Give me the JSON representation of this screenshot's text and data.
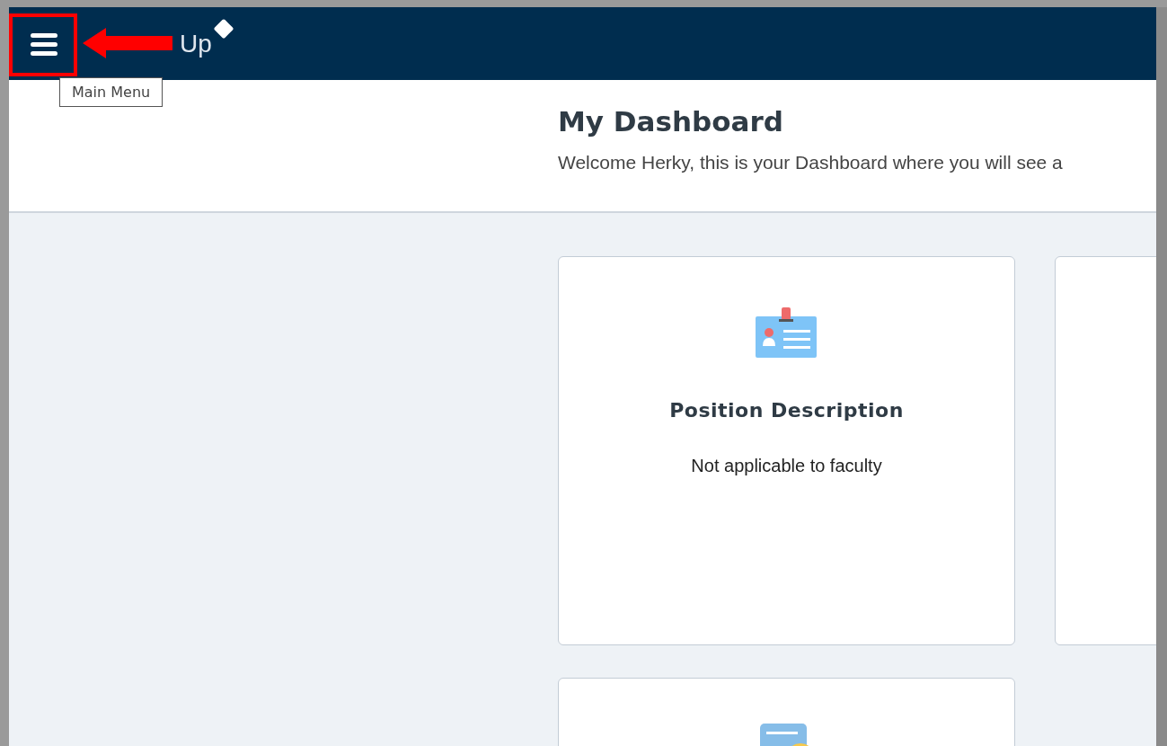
{
  "header": {
    "logo": "Up",
    "tooltip": "Main Menu"
  },
  "annotation": {
    "highlight": true
  },
  "page": {
    "title": "My Dashboard",
    "subtitle": "Welcome Herky, this is your Dashboard where you will see a"
  },
  "cards": [
    {
      "kind": "id",
      "title": "Position Description",
      "text": "Not applicable to faculty"
    },
    {
      "kind": "blank"
    },
    {
      "kind": "doc"
    }
  ]
}
